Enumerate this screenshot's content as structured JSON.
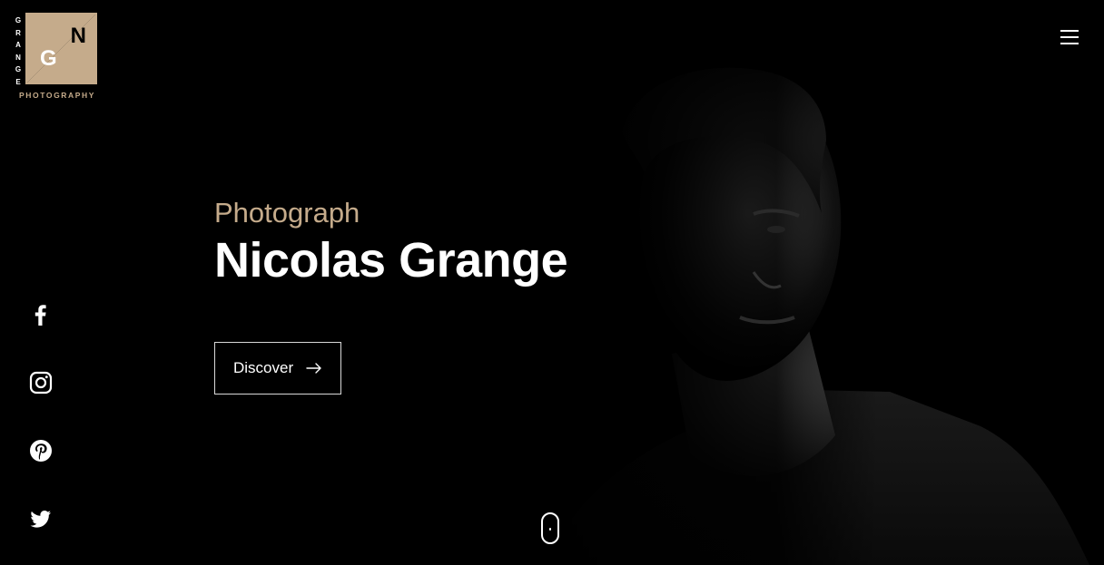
{
  "logo": {
    "vertical_letters": [
      "G",
      "R",
      "A",
      "N",
      "G",
      "E"
    ],
    "monogram_n": "N",
    "monogram_g": "G",
    "subtitle": "PHOTOGRAPHY"
  },
  "hero": {
    "kicker": "Photograph",
    "title": "Nicolas Grange",
    "cta_label": "Discover"
  },
  "colors": {
    "accent": "#c5ab8b",
    "background": "#000000",
    "text": "#ffffff"
  },
  "social": [
    "facebook-icon",
    "instagram-icon",
    "pinterest-icon",
    "twitter-icon"
  ]
}
